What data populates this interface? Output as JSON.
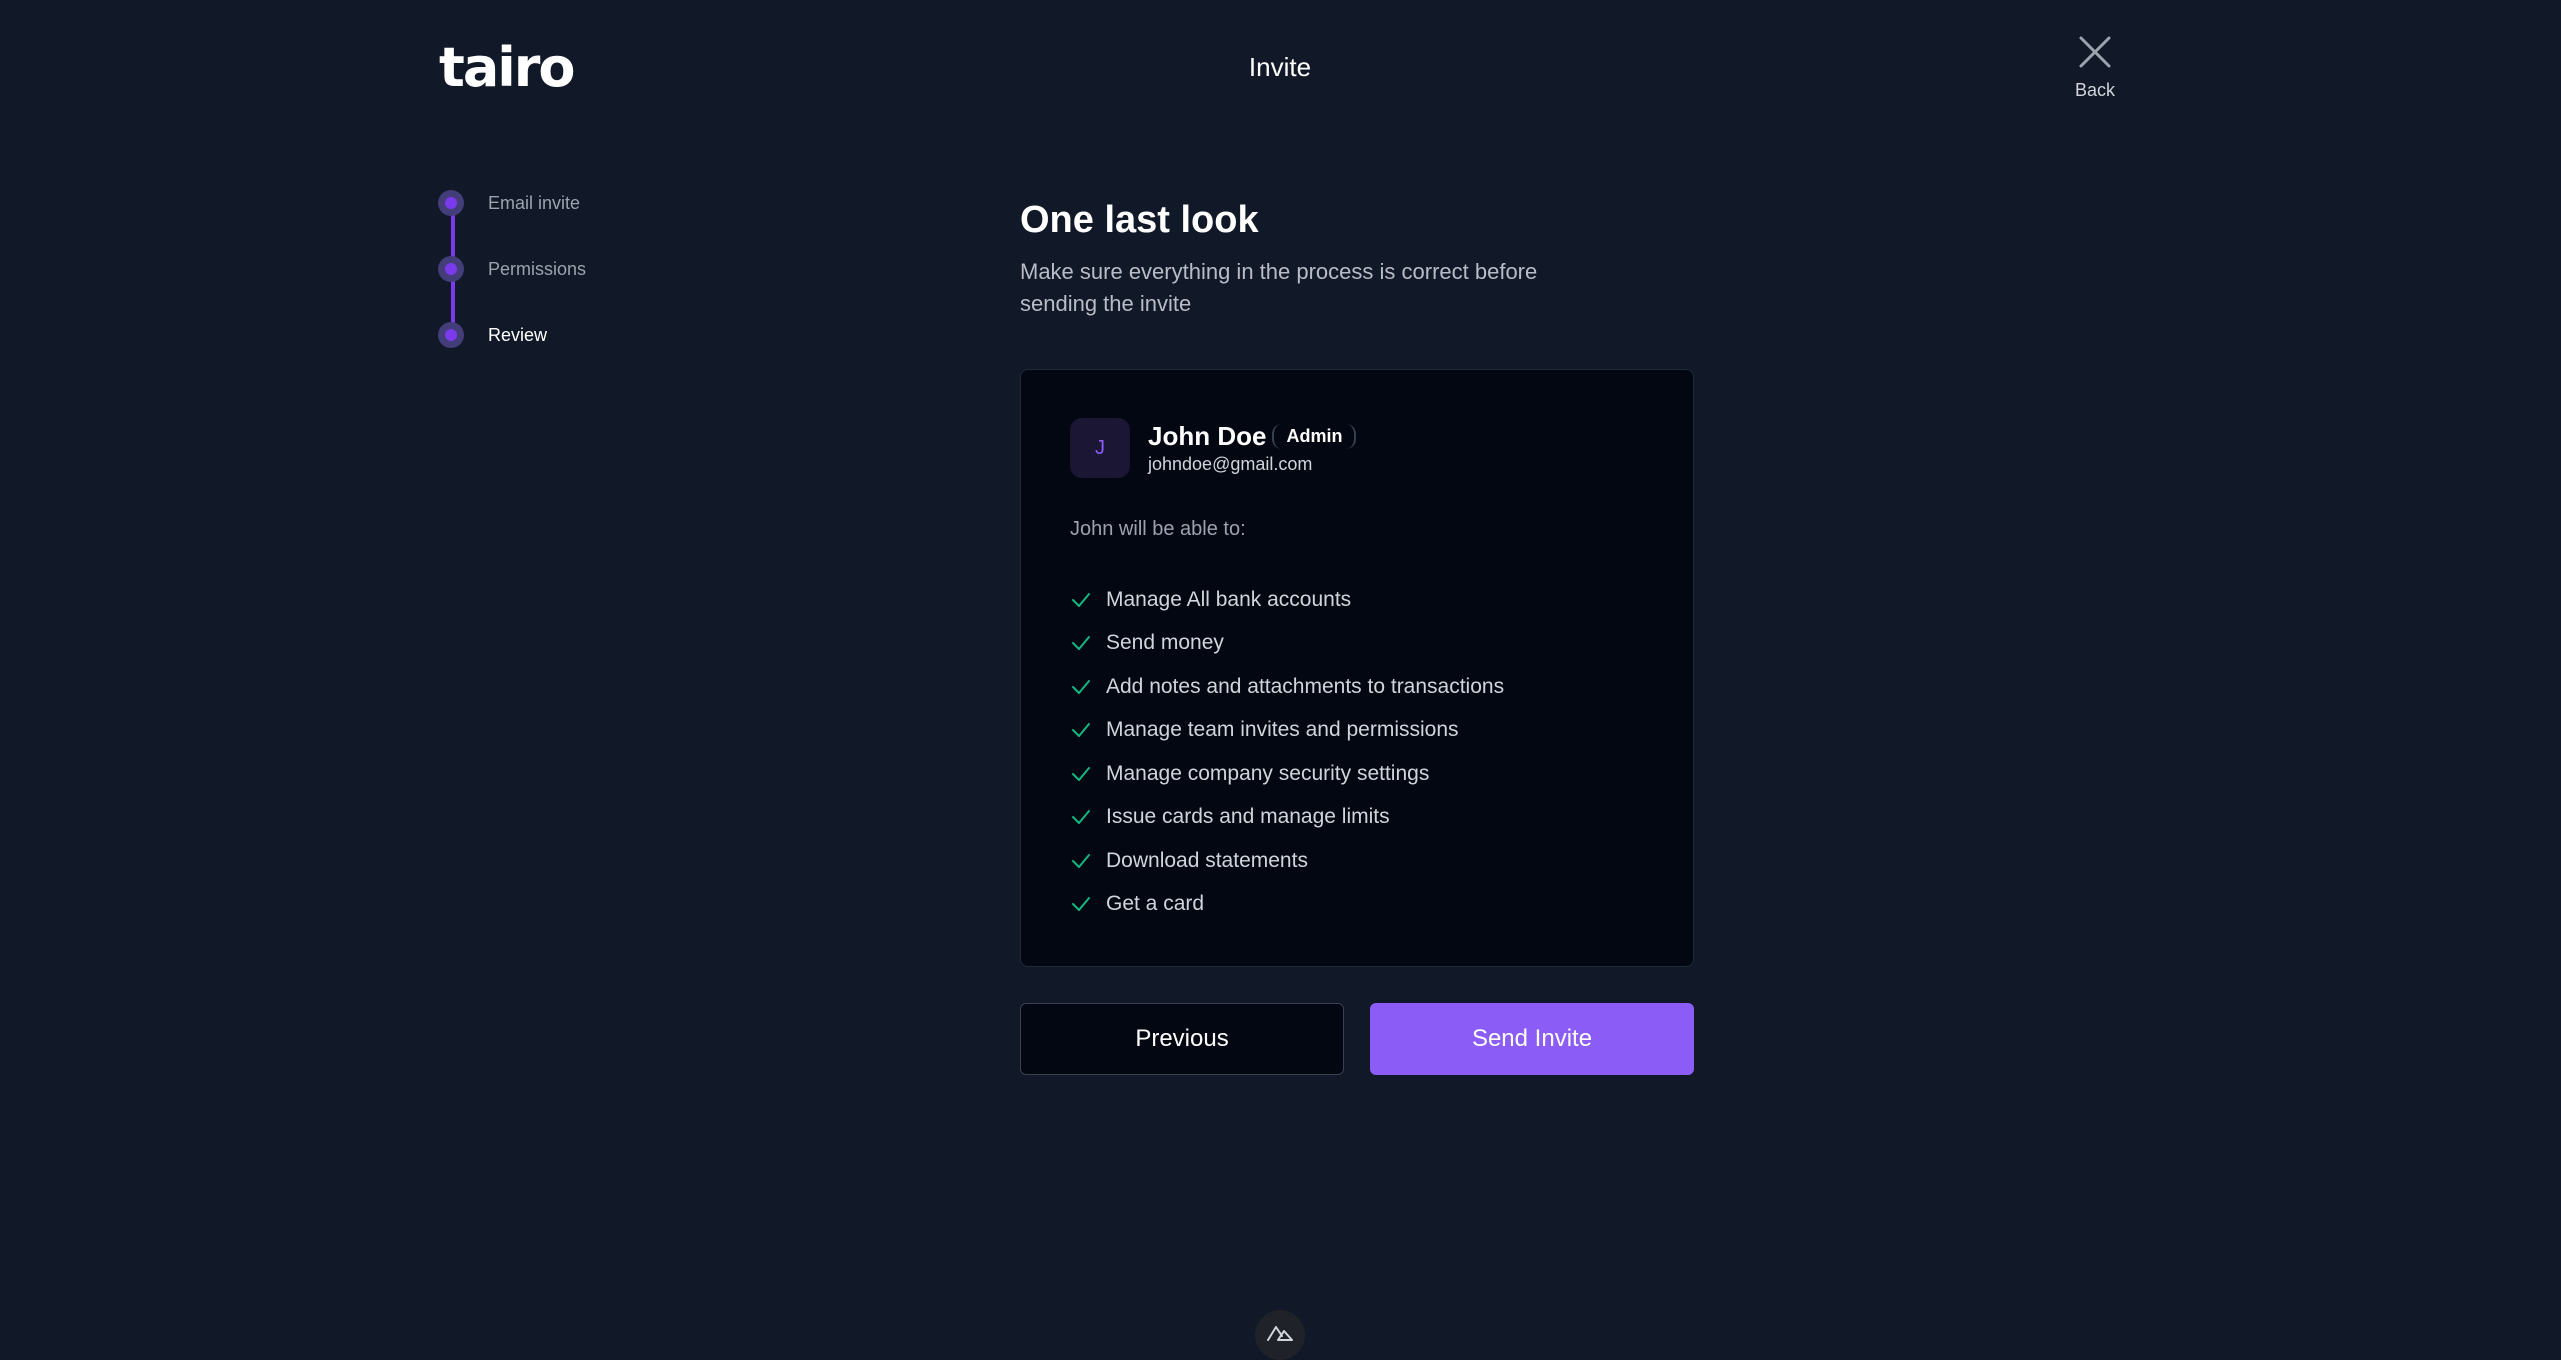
{
  "header": {
    "logo_text": "tairo",
    "title": "Invite",
    "back_label": "Back"
  },
  "stepper": {
    "steps": [
      {
        "label": "Email invite",
        "state": "completed"
      },
      {
        "label": "Permissions",
        "state": "completed"
      },
      {
        "label": "Review",
        "state": "active"
      }
    ]
  },
  "main": {
    "title": "One last look",
    "subtitle": "Make sure everything in the process is correct before sending the invite"
  },
  "card": {
    "user": {
      "avatar_initial": "J",
      "name": "John Doe",
      "role": "Admin",
      "email": "johndoe@gmail.com"
    },
    "abilities_intro": "John will be able to:",
    "abilities": [
      "Manage All bank accounts",
      "Send money",
      "Add notes and attachments to transactions",
      "Manage team invites and permissions",
      "Manage company security settings",
      "Issue cards and manage limits",
      "Download statements",
      "Get a card"
    ]
  },
  "actions": {
    "previous_label": "Previous",
    "send_label": "Send Invite"
  },
  "colors": {
    "background": "#111827",
    "card_background": "#030712",
    "accent": "#8b5cf6",
    "check": "#10b981"
  },
  "icons": {
    "close": "close-icon",
    "check": "check-icon",
    "dev_badge": "nuxt-devtools-icon"
  }
}
